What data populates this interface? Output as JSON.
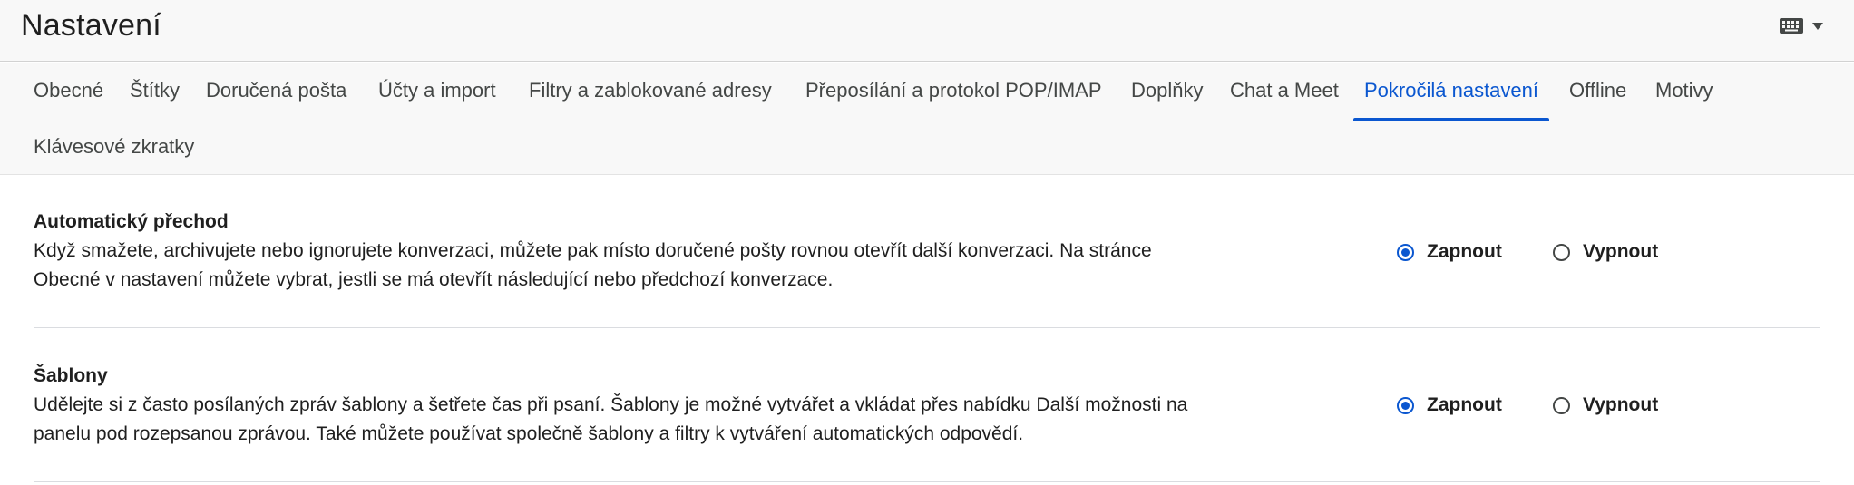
{
  "header": {
    "title": "Nastavení",
    "icons": [
      "keyboard-icon",
      "chevron-down-icon"
    ]
  },
  "tabs": [
    {
      "label": "Obecné",
      "active": false
    },
    {
      "label": "Štítky",
      "active": false
    },
    {
      "label": "Doručená pošta",
      "active": false
    },
    {
      "label": "Účty a import",
      "active": false
    },
    {
      "label": "Filtry a zablokované adresy",
      "active": false
    },
    {
      "label": "Přeposílání a protokol POP/IMAP",
      "active": false
    },
    {
      "label": "Doplňky",
      "active": false
    },
    {
      "label": "Chat a Meet",
      "active": false
    },
    {
      "label": "Pokročilá nastavení",
      "active": true
    },
    {
      "label": "Offline",
      "active": false
    },
    {
      "label": "Motivy",
      "active": false
    },
    {
      "label": "Klávesové zkratky",
      "active": false
    }
  ],
  "sections": [
    {
      "title": "Automatický přechod",
      "desc_line1": "Když smažete, archivujete nebo ignorujete konverzaci, můžete pak místo doručené pošty rovnou otevřít další konverzaci. Na stránce",
      "desc_line2": "Obecné v nastavení můžete vybrat, jestli se má otevřít následující nebo předchozí konverzace.",
      "option_on": "Zapnout",
      "option_off": "Vypnout",
      "selected": "Zapnout"
    },
    {
      "title": "Šablony",
      "desc_line1": "Udělejte si z často posílaných zpráv šablony a šetřete čas při psaní. Šablony je možné vytvářet a vkládat přes nabídku Další možnosti na",
      "desc_line2": "panelu pod rozepsanou zprávou. Také můžete používat společně šablony a filtry k vytváření automatických odpovědí.",
      "option_on": "Zapnout",
      "option_off": "Vypnout",
      "selected": "Zapnout"
    }
  ],
  "colors": {
    "accent": "#0b57d0",
    "header_bg": "#f8f8f8",
    "tab_text": "#444746"
  }
}
